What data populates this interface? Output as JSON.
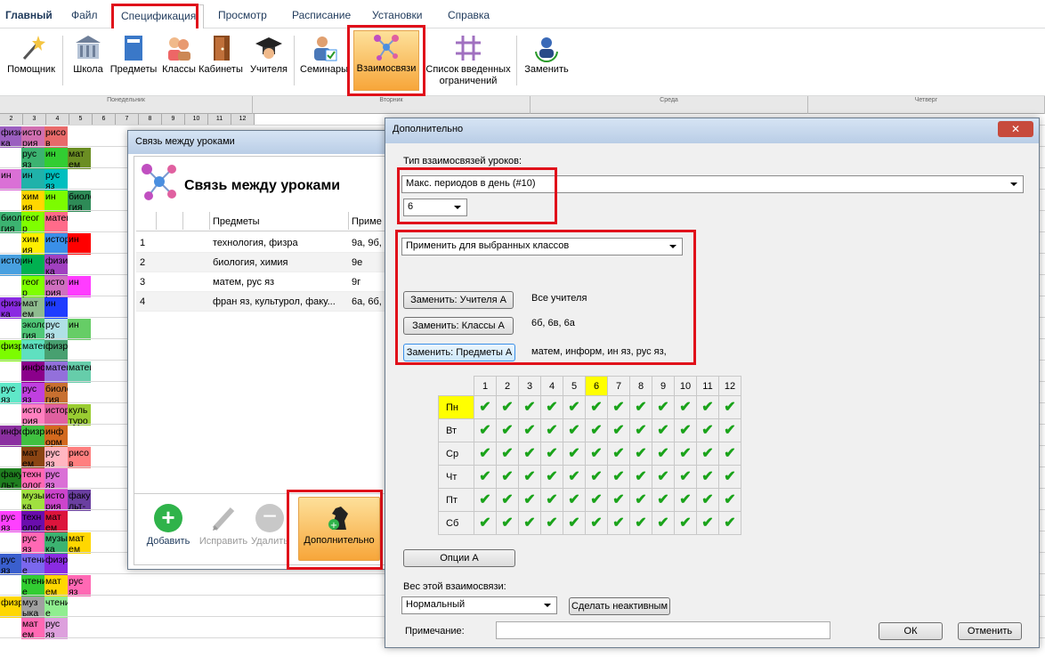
{
  "menubar": {
    "items": [
      "Главный",
      "Файл",
      "Спецификация",
      "Просмотр",
      "Расписание",
      "Установки",
      "Справка"
    ],
    "active_index": 2
  },
  "ribbon": {
    "buttons": [
      "Помощник",
      "Школа",
      "Предметы",
      "Классы",
      "Кабинеты",
      "Учителя",
      "Семинары",
      "Взаимосвязи",
      "Список введенных",
      "ограничений",
      "Заменить"
    ]
  },
  "timetable": {
    "days": [
      "Понедельник",
      "Вторник",
      "Среда",
      "Четверг"
    ],
    "periods": [
      "2",
      "3",
      "4",
      "5",
      "6",
      "7",
      "8",
      "9",
      "10",
      "11",
      "12"
    ],
    "cells": [
      {
        "text": "физи ка",
        "color": "#9b5fc0"
      },
      {
        "text": "исто рия",
        "color": "#d06fb0"
      },
      {
        "text": "рисо в",
        "color": "#e86a6a"
      },
      {
        "text": "рус яз",
        "color": "#3cb371"
      },
      {
        "text": "ин",
        "color": "#32cd32"
      },
      {
        "text": "мат ем",
        "color": "#6b8e23"
      },
      {
        "text": "ин",
        "color": "#da70d6"
      },
      {
        "text": "ин",
        "color": "#20b2aa"
      },
      {
        "text": "рус яз",
        "color": "#00bfbf"
      },
      {
        "text": "хим ия",
        "color": "#ffd700"
      },
      {
        "text": "ин",
        "color": "#7cfc00"
      },
      {
        "text": "биоло гия",
        "color": "#2e8b57"
      },
      {
        "text": "биоло гия",
        "color": "#3cb371"
      },
      {
        "text": "геог р",
        "color": "#7fff00"
      },
      {
        "text": "матем",
        "color": "#ff6b8a"
      },
      {
        "text": "хим ия",
        "color": "#ffee00"
      },
      {
        "text": "история",
        "color": "#3a8fe8"
      },
      {
        "text": "ин",
        "color": "#ff0000"
      },
      {
        "text": "история",
        "color": "#48a0e0"
      },
      {
        "text": "ин",
        "color": "#00b050"
      },
      {
        "text": "физи ка",
        "color": "#a040c0"
      },
      {
        "text": "геог р",
        "color": "#7fff00"
      },
      {
        "text": "исто рия",
        "color": "#d070c0"
      },
      {
        "text": "ин",
        "color": "#ff3cff"
      },
      {
        "text": "физи ка",
        "color": "#8a2be2"
      },
      {
        "text": "мат ем",
        "color": "#8fbc8f"
      },
      {
        "text": "ин",
        "color": "#1e3cff"
      },
      {
        "text": "эколо гия",
        "color": "#50c878"
      },
      {
        "text": "рус яз",
        "color": "#b0e0e6"
      },
      {
        "text": "ин",
        "color": "#66cd66"
      },
      {
        "text": "физр",
        "color": "#7cfc00"
      },
      {
        "text": "матем",
        "color": "#5fe0c0"
      },
      {
        "text": "физр",
        "color": "#48a070"
      },
      {
        "text": "инфор",
        "color": "#8b008b"
      },
      {
        "text": "матем",
        "color": "#9370db"
      },
      {
        "text": "матем",
        "color": "#66cdaa"
      },
      {
        "text": "рус яз",
        "color": "#5fe8c8"
      },
      {
        "text": "рус яз",
        "color": "#c040e0"
      },
      {
        "text": "биоло гия",
        "color": "#c87030"
      },
      {
        "text": "исто рия",
        "color": "#ff80c0"
      },
      {
        "text": "история",
        "color": "#e060a0"
      },
      {
        "text": "куль туро",
        "color": "#9acd32"
      },
      {
        "text": "инфор",
        "color": "#8b2fa0"
      },
      {
        "text": "физр",
        "color": "#40c040"
      },
      {
        "text": "инф орм",
        "color": "#d2691e"
      },
      {
        "text": "мат ем",
        "color": "#8b4513"
      },
      {
        "text": "рус яз",
        "color": "#ffb6c1"
      },
      {
        "text": "рисо в",
        "color": "#ff7f7f"
      },
      {
        "text": "факу льт-",
        "color": "#1f7f1f"
      },
      {
        "text": "техн олог",
        "color": "#ff69b4"
      },
      {
        "text": "рус яз",
        "color": "#da70d6"
      },
      {
        "text": "музы ка",
        "color": "#a0e040"
      },
      {
        "text": "исто рия",
        "color": "#cc44cc"
      },
      {
        "text": "факу льт-",
        "color": "#6a3fa0"
      },
      {
        "text": "рус яз",
        "color": "#ff40ff"
      },
      {
        "text": "техн олог",
        "color": "#6a0dad"
      },
      {
        "text": "мат ем",
        "color": "#dc143c"
      },
      {
        "text": "рус яз",
        "color": "#ff69b4"
      },
      {
        "text": "музы ка",
        "color": "#3cb371"
      },
      {
        "text": "мат ем",
        "color": "#ffd700"
      },
      {
        "text": "рус яз",
        "color": "#3a5fcd"
      },
      {
        "text": "чтени е",
        "color": "#7b68ee"
      },
      {
        "text": "физр",
        "color": "#8a2be2"
      },
      {
        "text": "чтени е",
        "color": "#32cd32"
      },
      {
        "text": "мат ем",
        "color": "#ffd700"
      },
      {
        "text": "рус яз",
        "color": "#ff69b4"
      },
      {
        "text": "физр",
        "color": "#ffd700"
      },
      {
        "text": "муз ыка",
        "color": "#a0a0a0"
      },
      {
        "text": "чтени е",
        "color": "#90ee90"
      },
      {
        "text": "мат ем",
        "color": "#ff69b4"
      },
      {
        "text": "рус яз",
        "color": "#dda0dd"
      }
    ]
  },
  "links_window": {
    "title": "Связь между уроками",
    "heading": "Связь между уроками",
    "columns": [
      "Предметы",
      "Приме"
    ],
    "rows": [
      {
        "num": "1",
        "subjects": "технология, физра",
        "classes": "9а, 9б,"
      },
      {
        "num": "2",
        "subjects": "биология, химия",
        "classes": "9е"
      },
      {
        "num": "3",
        "subjects": "матем, рус яз",
        "classes": "9г"
      },
      {
        "num": "4",
        "subjects": "фран яз, культурол, факу...",
        "classes": "6а, 6б,"
      }
    ],
    "buttons": {
      "add": "Добавить",
      "edit": "Исправить",
      "delete": "Удалить",
      "extra": "Дополнительно"
    }
  },
  "extra_dialog": {
    "title": "Дополнительно",
    "type_label": "Тип взаимосвязей уроков:",
    "type_value": "Макс. периодов в день (#10)",
    "count_value": "6",
    "apply_value": "Применить для выбранных классов",
    "replace_teachers_btn": "Заменить: Учителя А",
    "replace_teachers_val": "Все учителя",
    "replace_classes_btn": "Заменить: Классы А",
    "replace_classes_val": "6б, 6в, 6а",
    "replace_subjects_btn": "Заменить: Предметы А",
    "replace_subjects_val": "матем, информ, ин яз, рус яз,",
    "periods": [
      "1",
      "2",
      "3",
      "4",
      "5",
      "6",
      "7",
      "8",
      "9",
      "10",
      "11",
      "12"
    ],
    "highlight_period": "6",
    "days": [
      "Пн",
      "Вт",
      "Ср",
      "Чт",
      "Пт",
      "Сб"
    ],
    "options_btn": "Опции А",
    "weight_label": "Вес этой взаимосвязи:",
    "weight_value": "Нормальный",
    "inactive_btn": "Сделать неактивным",
    "note_label": "Примечание:",
    "note_value": "",
    "ok_btn": "ОК",
    "cancel_btn": "Отменить",
    "close_symbol": "✕"
  }
}
